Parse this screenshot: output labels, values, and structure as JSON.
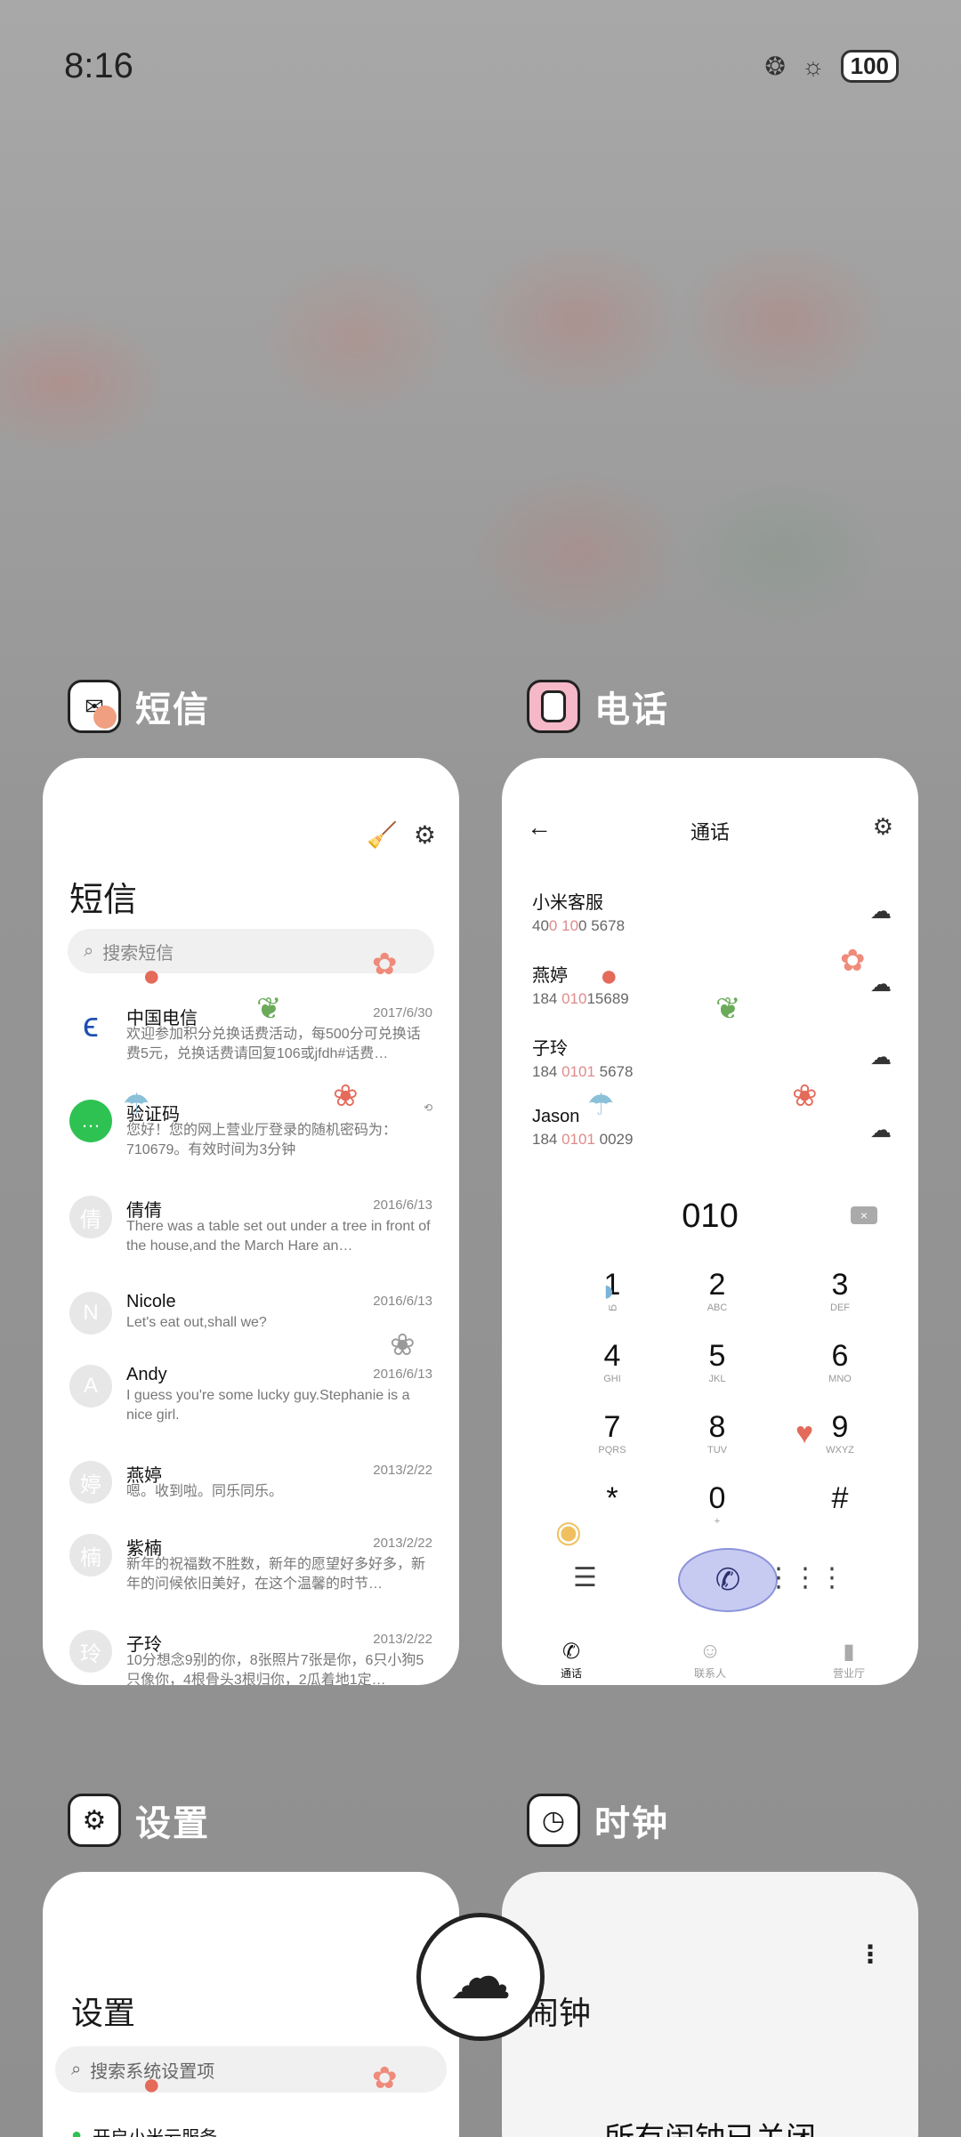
{
  "status": {
    "time": "8:16",
    "battery": "100"
  },
  "apps": {
    "sms": {
      "label": "短信"
    },
    "phone": {
      "label": "电话"
    },
    "settings": {
      "label": "设置"
    },
    "clock": {
      "label": "时钟"
    }
  },
  "sms": {
    "title": "短信",
    "search_placeholder": "搜索短信",
    "messages": [
      {
        "avatar": "",
        "name": "中国电信",
        "date": "2017/6/30",
        "text": "欢迎参加积分兑换话费活动，每500分可兑换话费5元，兑换话费请回复106或jfdh#话费…"
      },
      {
        "avatar": "",
        "name": "验证码",
        "date": "",
        "text": "您好！您的网上营业厅登录的随机密码为：710679。有效时间为3分钟"
      },
      {
        "avatar": "倩",
        "name": "倩倩",
        "date": "2016/6/13",
        "text": "There was a table set out under a tree in front of the house,and the March Hare an…"
      },
      {
        "avatar": "N",
        "name": "Nicole",
        "date": "2016/6/13",
        "text": "Let's eat out,shall we?"
      },
      {
        "avatar": "A",
        "name": "Andy",
        "date": "2016/6/13",
        "text": "I guess you're some lucky guy.Stephanie is a nice girl."
      },
      {
        "avatar": "婷",
        "name": "燕婷",
        "date": "2013/2/22",
        "text": "嗯。收到啦。同乐同乐。"
      },
      {
        "avatar": "楠",
        "name": "紫楠",
        "date": "2013/2/22",
        "text": "新年的祝福数不胜数，新年的愿望好多好多，新年的问候依旧美好，在这个温馨的时节…"
      },
      {
        "avatar": "玲",
        "name": "子玲",
        "date": "2013/2/22",
        "text": "10分想念9别的你，8张照片7张是你，6只小狗5只像你，4根骨头3根归你，2瓜着地1定…"
      }
    ]
  },
  "phone": {
    "title": "通话",
    "contacts": [
      {
        "name": "小米客服",
        "pre": "40",
        "hl1": "0",
        "mid": " ",
        "hl2": "10",
        "post": "0 5678"
      },
      {
        "name": "燕婷",
        "pre": "184 ",
        "hl1": "010",
        "mid": "",
        "hl2": "",
        "post": "15689"
      },
      {
        "name": "子玲",
        "pre": "184 ",
        "hl1": "0101",
        "mid": "",
        "hl2": "",
        "post": " 5678"
      },
      {
        "name": "Jason",
        "pre": "184 ",
        "hl1": "0101",
        "mid": "",
        "hl2": "",
        "post": " 0029"
      }
    ],
    "dial_input": "010",
    "keys": [
      {
        "d": "1",
        "l": "ഥ"
      },
      {
        "d": "2",
        "l": "ABC"
      },
      {
        "d": "3",
        "l": "DEF"
      },
      {
        "d": "4",
        "l": "GHI"
      },
      {
        "d": "5",
        "l": "JKL"
      },
      {
        "d": "6",
        "l": "MNO"
      },
      {
        "d": "7",
        "l": "PQRS"
      },
      {
        "d": "8",
        "l": "TUV"
      },
      {
        "d": "9",
        "l": "WXYZ"
      },
      {
        "d": "*",
        "l": ""
      },
      {
        "d": "0",
        "l": "+"
      },
      {
        "d": "#",
        "l": ""
      }
    ],
    "tabs": [
      {
        "label": "通话",
        "icon": "phone-icon"
      },
      {
        "label": "联系人",
        "icon": "contacts-icon"
      },
      {
        "label": "营业厅",
        "icon": "store-icon"
      }
    ]
  },
  "settings": {
    "title": "设置",
    "search_placeholder": "搜索系统设置项",
    "first_item": "开启小米云服务"
  },
  "clock": {
    "title": "闹钟",
    "message": "所有闹钟已关闭"
  },
  "colors": {
    "accent": "#c7cbf2",
    "highlight": "#e08a8a"
  }
}
